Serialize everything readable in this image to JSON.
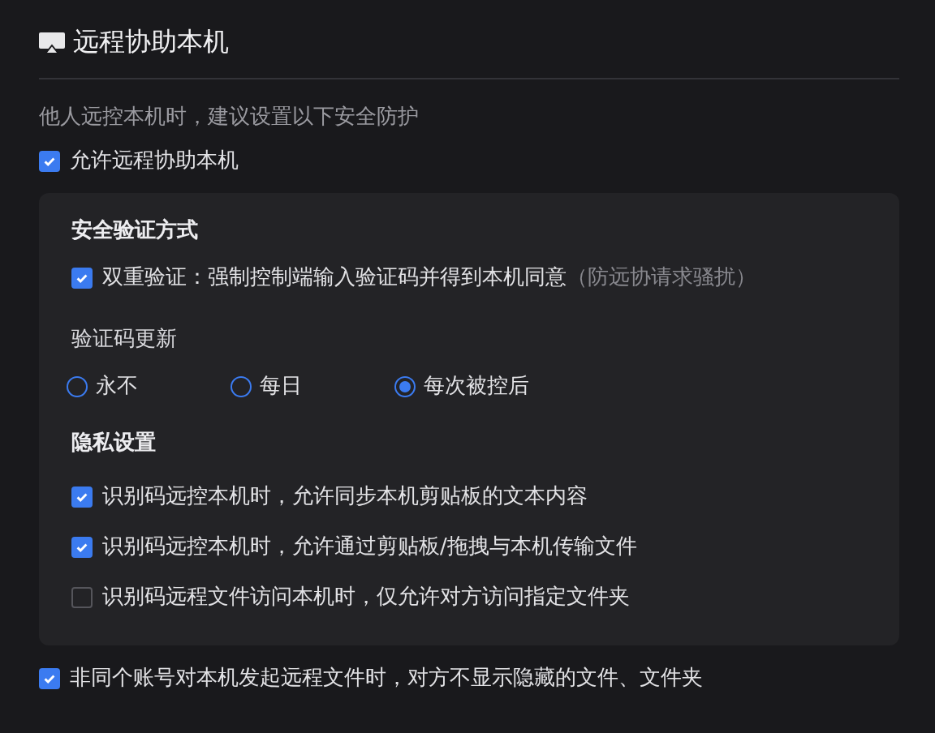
{
  "header": {
    "title": "远程协助本机"
  },
  "description": "他人远控本机时，建议设置以下安全防护",
  "allow_remote": {
    "label": "允许远程协助本机",
    "checked": true
  },
  "panel": {
    "verification": {
      "title": "安全验证方式",
      "option": {
        "label": "双重验证：强制控制端输入验证码并得到本机同意",
        "hint": "（防远协请求骚扰）",
        "checked": true
      }
    },
    "code_refresh": {
      "title": "验证码更新",
      "options": [
        {
          "label": "永不",
          "selected": false
        },
        {
          "label": "每日",
          "selected": false
        },
        {
          "label": "每次被控后",
          "selected": true
        }
      ]
    },
    "privacy": {
      "title": "隐私设置",
      "options": [
        {
          "label": "识别码远控本机时，允许同步本机剪贴板的文本内容",
          "checked": true
        },
        {
          "label": "识别码远控本机时，允许通过剪贴板/拖拽与本机传输文件",
          "checked": true
        },
        {
          "label": "识别码远程文件访问本机时，仅允许对方访问指定文件夹",
          "checked": false
        }
      ]
    }
  },
  "hide_hidden_files": {
    "label": "非同个账号对本机发起远程文件时，对方不显示隐藏的文件、文件夹",
    "checked": true
  }
}
